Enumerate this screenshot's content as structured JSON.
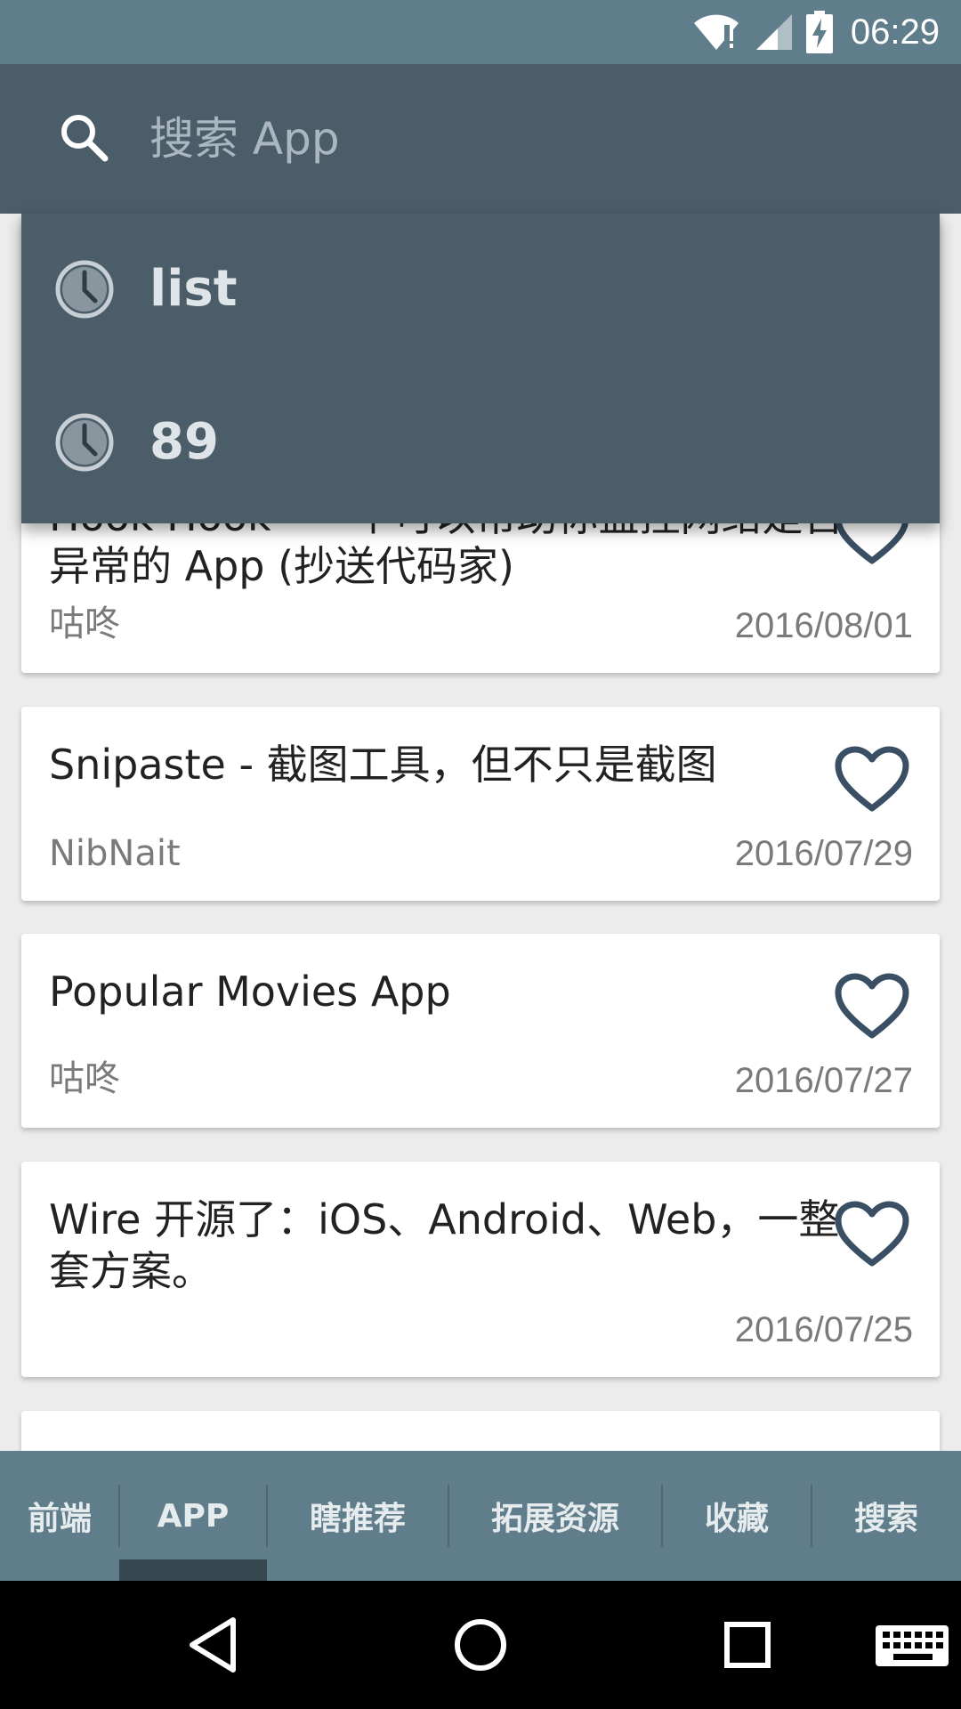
{
  "status_bar": {
    "time": "06:29"
  },
  "search": {
    "placeholder": "搜索 App",
    "value": ""
  },
  "suggestions": [
    {
      "text": "list"
    },
    {
      "text": "89"
    }
  ],
  "cards": [
    {
      "title_hidden_line": "Hook Hook - 一个可以帮助你监控网络是否",
      "title": "异常的 App (抄送代码家)",
      "author": "咕咚",
      "date": "2016/08/01"
    },
    {
      "title": "Snipaste - 截图工具，但不只是截图",
      "author": "NibNait",
      "date": "2016/07/29"
    },
    {
      "title": "Popular Movies App",
      "author": "咕咚",
      "date": "2016/07/27"
    },
    {
      "title": "Wire 开源了：iOS、Android、Web，一整套方案。",
      "author": "",
      "date": "2016/07/25"
    }
  ],
  "tabs": [
    {
      "label": "前端",
      "selected": false
    },
    {
      "label": "APP",
      "selected": true
    },
    {
      "label": "瞎推荐",
      "selected": false
    },
    {
      "label": "拓展资源",
      "selected": false
    },
    {
      "label": "收藏",
      "selected": false
    },
    {
      "label": "搜索",
      "selected": false
    }
  ],
  "colors": {
    "status_bar": "#607d8b",
    "search_bar": "#4b5d69",
    "tab_bar": "#607d8b",
    "tab_indicator": "#37474f",
    "heart": "#3a4f63"
  },
  "icons": {
    "status": [
      "wifi-icon",
      "signal-icon",
      "battery-charging-icon"
    ],
    "search": "search-icon",
    "suggestion": "history-clock-icon",
    "favorite": "heart-outline-icon",
    "nav": [
      "back-icon",
      "home-icon",
      "recents-icon",
      "keyboard-icon"
    ]
  }
}
